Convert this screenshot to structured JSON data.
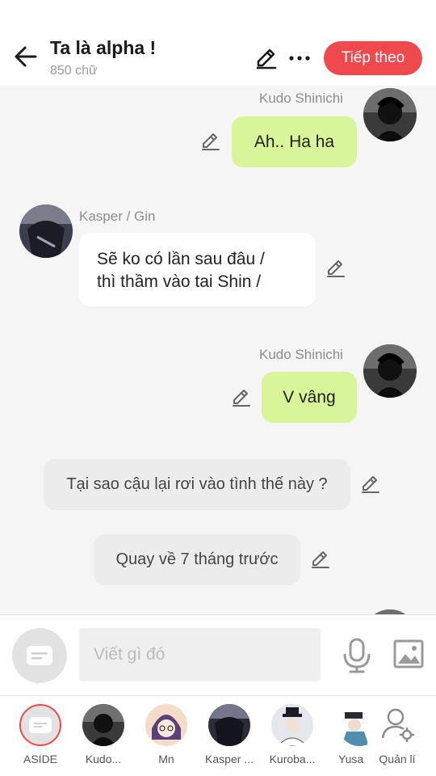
{
  "header": {
    "title": "Ta là alpha !",
    "word_count": "850 chữ",
    "next_label": "Tiếp theo",
    "accent": "#f0494d"
  },
  "messages": [
    {
      "speaker": "Kudo Shinichi",
      "text": "Ah.. Ha ha",
      "side": "right"
    },
    {
      "speaker": "Kasper / Gin",
      "text_line1": "Sẽ ko có lần sau đâu /",
      "text_line2": "thì thầm vào tai Shin /",
      "side": "left"
    },
    {
      "speaker": "Kudo Shinichi",
      "text": "V vâng",
      "side": "right"
    },
    {
      "text": "Tại sao cậu lại rơi vào tình thế này ?",
      "type": "narration"
    },
    {
      "text": "Quay về 7 tháng trước",
      "type": "narration"
    }
  ],
  "composer": {
    "placeholder": "Viết gì đó"
  },
  "characters": [
    {
      "label": "ASIDE",
      "icon": "chat-bubble-icon"
    },
    {
      "label": "Kudo..."
    },
    {
      "label": "Mn"
    },
    {
      "label": "Kasper ..."
    },
    {
      "label": "Kuroba..."
    },
    {
      "label": "Yusa"
    },
    {
      "label": "Quản lí",
      "icon": "person-settings-icon"
    }
  ],
  "colors": {
    "green_bubble": "#d9f59a",
    "background": "#f5f5f5"
  }
}
